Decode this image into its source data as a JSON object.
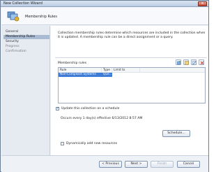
{
  "window": {
    "title": "New Collection Wizard",
    "close_glyph": "×"
  },
  "header": {
    "title": "Membership Rules",
    "icon": "collection-wizard-icon"
  },
  "nav": {
    "items": [
      {
        "label": "General"
      },
      {
        "label": "Membership Rules"
      },
      {
        "label": "Security"
      },
      {
        "label": "Progress"
      },
      {
        "label": "Confirmation"
      }
    ]
  },
  "content": {
    "description": "Collection membership rules determine which resources are included in the collection when it is updated. A membership rule can be a direct assignment or a query.",
    "membership_rules_label": "Membership rules",
    "table": {
      "columns": [
        "Rule",
        "Type",
        "Limit to"
      ],
      "rows": [
        {
          "rule": "Non-Compliant Systems",
          "type": "Que...",
          "limit": "<unlimited>"
        }
      ]
    },
    "update_schedule": {
      "label": "Update this collection on a schedule",
      "checked": true,
      "text": "Occurs every 1 day(s) effective 6/13/2012 8:57 AM",
      "button": "Schedule..."
    },
    "dynamic": {
      "label": "Dynamically add new resources",
      "checked": false
    }
  },
  "footer": {
    "previous": "< Previous",
    "next": "Next >",
    "finish": "Finish",
    "cancel": "Cancel"
  },
  "colors": {
    "selection": "#3d7bd6",
    "nav_selected": "#a9bad3",
    "close_button": "#c7452e"
  }
}
